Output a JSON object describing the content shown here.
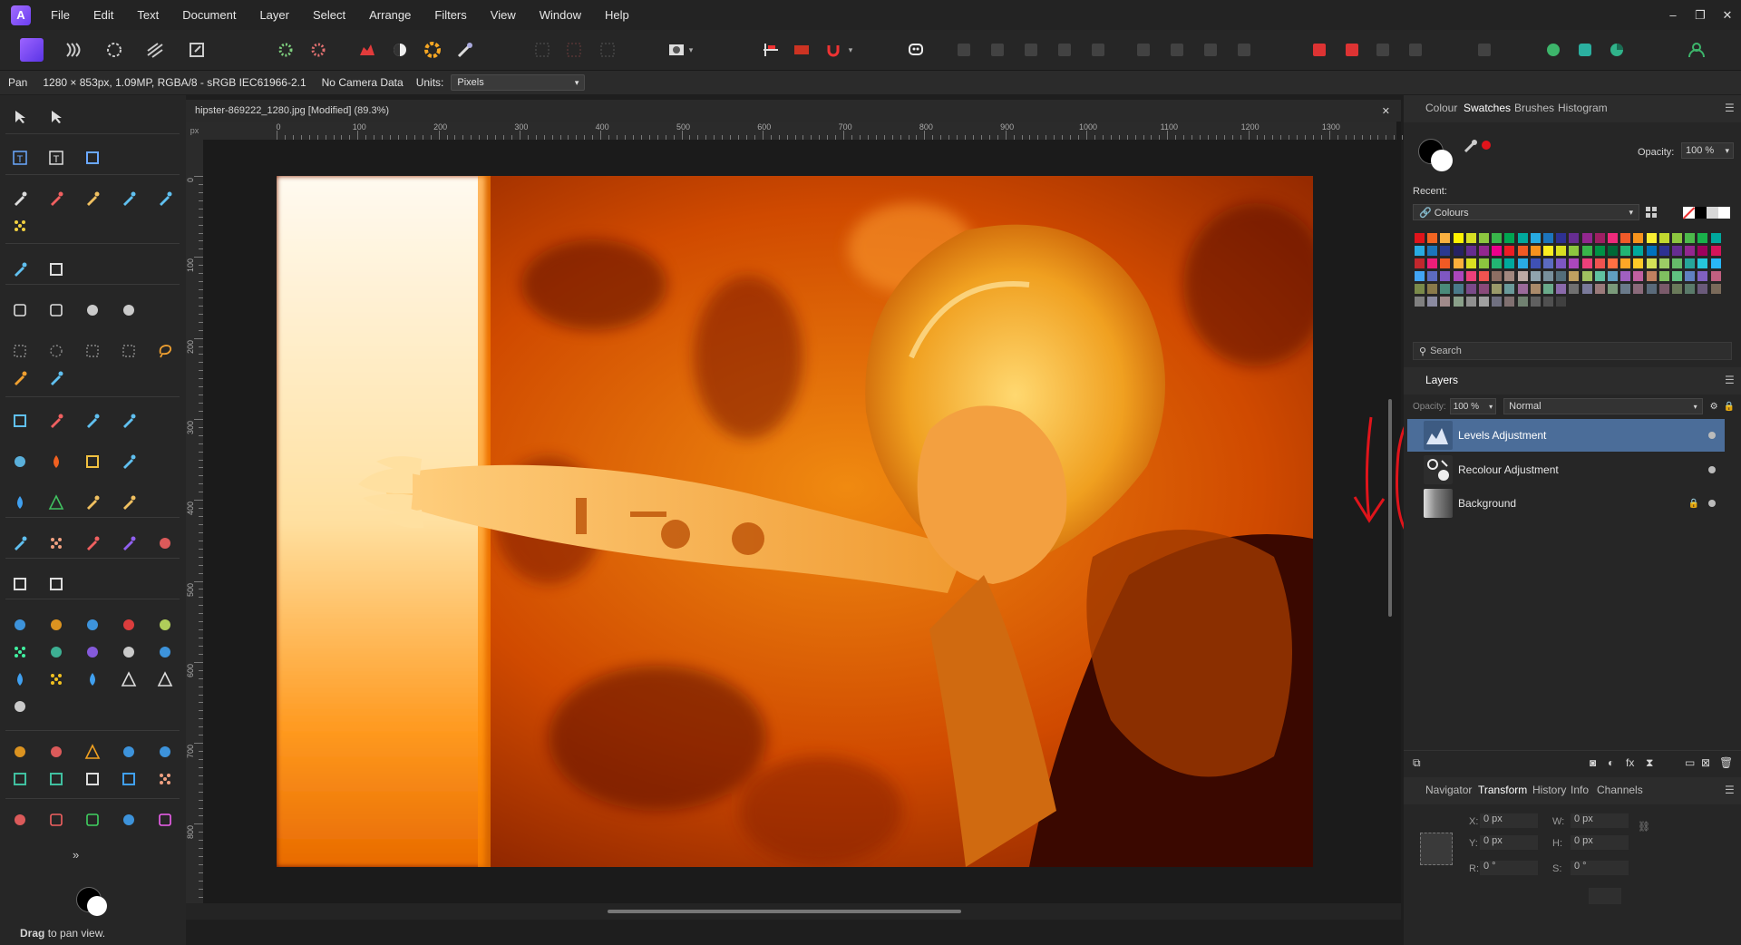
{
  "menubar": {
    "logo": "affinity-photo-logo",
    "items": [
      "File",
      "Edit",
      "Text",
      "Document",
      "Layer",
      "Select",
      "Arrange",
      "Filters",
      "View",
      "Window",
      "Help"
    ],
    "window_controls": [
      "–",
      "❐",
      "✕"
    ]
  },
  "context_bar": {
    "tool": "Pan",
    "image_info": "1280 × 853px, 1.09MP, RGBA/8 - sRGB IEC61966-2.1",
    "camera": "No Camera Data",
    "units_label": "Units:",
    "units_value": "Pixels"
  },
  "document": {
    "tab_title": "hipster-869222_1280.jpg [Modified] (89.3%)",
    "close": "✕",
    "ruler_unit": "px",
    "h_ticks": [
      "0",
      "100",
      "200",
      "300",
      "400",
      "500",
      "600",
      "700",
      "800",
      "900",
      "1000",
      "1100",
      "1200",
      "1300"
    ],
    "v_ticks": [
      "0",
      "100",
      "200",
      "300",
      "400",
      "500",
      "600",
      "700",
      "800"
    ]
  },
  "tools_panel": {
    "status_bold": "Drag",
    "status_text": "to pan view.",
    "more": "»"
  },
  "colour_panel": {
    "tabs": [
      "Colour",
      "Swatches",
      "Brushes",
      "Histogram"
    ],
    "active_tab": "Swatches",
    "opacity_label": "Opacity:",
    "opacity_value": "100 %",
    "recent_label": "Recent:",
    "palette_name": "Colours",
    "search_placeholder": "Search"
  },
  "layers_panel": {
    "title": "Layers",
    "opacity_label": "Opacity:",
    "opacity_value": "100 %",
    "blend_mode": "Normal",
    "layers": [
      {
        "name": "Levels Adjustment",
        "selected": true
      },
      {
        "name": "Recolour Adjustment",
        "selected": false
      },
      {
        "name": "Background",
        "selected": false,
        "locked": true
      }
    ]
  },
  "transform_panel": {
    "tabs": [
      "Navigator",
      "Transform",
      "History",
      "Info",
      "Channels"
    ],
    "active_tab": "Transform",
    "x_label": "X:",
    "x_value": "0 px",
    "y_label": "Y:",
    "y_value": "0 px",
    "w_label": "W:",
    "w_value": "0 px",
    "h_label": "H:",
    "h_value": "0 px",
    "r_label": "R:",
    "r_value": "0 °",
    "s_label": "S:",
    "s_value": "0 °"
  },
  "colors": {
    "accent": "#5a7ba8",
    "annotation": "#e0141b",
    "photo_dark": "#3a0800",
    "photo_orange": "#e86a00",
    "photo_light": "#fff3d6"
  }
}
